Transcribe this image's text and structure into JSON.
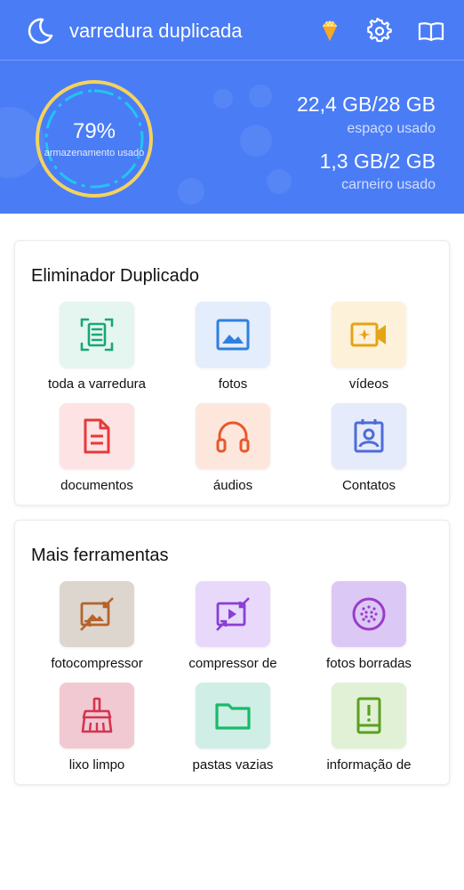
{
  "header": {
    "title": "varredura duplicada",
    "icons": [
      "moon-icon",
      "diamond-icon",
      "gear-icon",
      "book-icon"
    ],
    "storage": {
      "percent_label": "79%",
      "percent": 79,
      "label": "armazenamento usado"
    },
    "space": {
      "value": "22,4 GB/28 GB",
      "label": "espaço usado"
    },
    "ram": {
      "value": "1,3 GB/2 GB",
      "label": "carneiro usado"
    },
    "colors": {
      "background": "#4a7cf6",
      "gauge_ring": "#f4d35e",
      "gauge_inner": "#22c5f0"
    }
  },
  "duplicates": {
    "title": "Eliminador Duplicado",
    "items": [
      {
        "label": "toda a varredura",
        "icon": "scan-document-icon",
        "bg": "#e4f6ef",
        "color": "#1aa57a"
      },
      {
        "label": "fotos",
        "icon": "image-icon",
        "bg": "#e3edfb",
        "color": "#2f7fe0"
      },
      {
        "label": "vídeos",
        "icon": "video-icon",
        "bg": "#fdf1d9",
        "color": "#e5a414"
      },
      {
        "label": "documentos",
        "icon": "document-icon",
        "bg": "#fde3e4",
        "color": "#e53a3a"
      },
      {
        "label": "áudios",
        "icon": "headphones-icon",
        "bg": "#fde7dd",
        "color": "#e8582a"
      },
      {
        "label": "Contatos",
        "icon": "contact-icon",
        "bg": "#e6ebfb",
        "color": "#4f6bd8"
      }
    ]
  },
  "tools": {
    "title": "Mais ferramentas",
    "items": [
      {
        "label": "fotocompressor",
        "icon": "photo-compress-icon",
        "bg": "#ddd6cf",
        "color": "#b7632a"
      },
      {
        "label": "compressor de",
        "icon": "video-compress-icon",
        "bg": "#e8d9fb",
        "color": "#8a3fd6"
      },
      {
        "label": "fotos borradas",
        "icon": "blur-icon",
        "bg": "#dcc8f5",
        "color": "#9a3cc9"
      },
      {
        "label": "lixo limpo",
        "icon": "broom-icon",
        "bg": "#f1c9d2",
        "color": "#d6334e"
      },
      {
        "label": "pastas vazias",
        "icon": "folder-icon",
        "bg": "#cfeee5",
        "color": "#1aba6a"
      },
      {
        "label": "informação de",
        "icon": "phone-info-icon",
        "bg": "#e1f1d5",
        "color": "#5aa022"
      }
    ]
  }
}
